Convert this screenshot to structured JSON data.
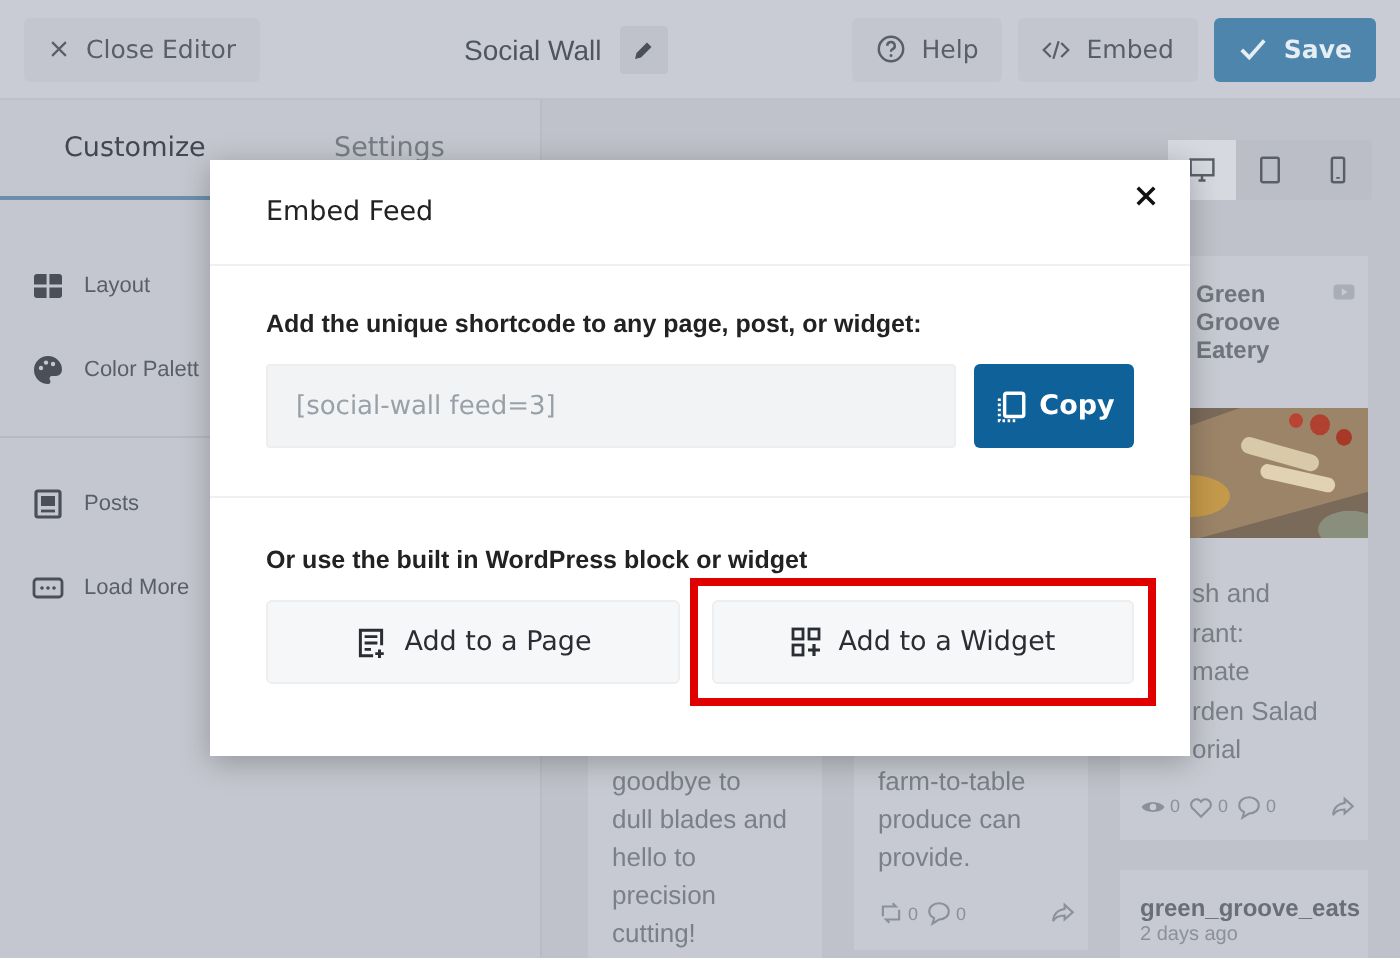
{
  "topbar": {
    "close": "Close Editor",
    "title": "Social Wall",
    "help": "Help",
    "embed": "Embed",
    "save": "Save"
  },
  "sidebar": {
    "tabs": [
      {
        "label": "Customize",
        "selected": true
      },
      {
        "label": "Settings",
        "selected": false
      }
    ],
    "items": [
      {
        "kind": "layout",
        "label": "Layout"
      },
      {
        "kind": "palette",
        "label": "Color Palett"
      },
      {
        "kind": "divider"
      },
      {
        "kind": "posts",
        "label": "Posts"
      },
      {
        "kind": "more",
        "label": "Load More"
      }
    ]
  },
  "preview": {
    "devices": [
      {
        "kind": "desktop",
        "selected": true
      },
      {
        "kind": "tablet",
        "selected": false
      },
      {
        "kind": "phone",
        "selected": false
      }
    ],
    "columns": [
      {
        "cards": [
          {
            "lines": [
              "goodbye to",
              "dull blades and",
              "hello to",
              "precision",
              "cutting!"
            ]
          }
        ]
      },
      {
        "cards": [
          {
            "lines": [
              "farm-to-table",
              "produce can",
              "provide."
            ],
            "stats": [
              {
                "kind": "retweet",
                "count": "0"
              },
              {
                "kind": "comment",
                "count": "0"
              },
              {
                "kind": "share"
              }
            ]
          }
        ]
      },
      {
        "cards": [
          {
            "author": "Green Groove Eatery",
            "picture": true,
            "lines": [
              "sh and",
              "rant:",
              "mate",
              "rden Salad",
              "orial"
            ],
            "stats": [
              {
                "kind": "views",
                "count": "0"
              },
              {
                "kind": "like",
                "count": "0"
              },
              {
                "kind": "comment",
                "count": "0"
              },
              {
                "kind": "share"
              }
            ]
          },
          {
            "handle": "green_groove_eats",
            "time": "2 days ago"
          }
        ]
      }
    ]
  },
  "modal": {
    "title": "Embed Feed",
    "shortcode_label": "Add the unique shortcode to any page, post, or widget:",
    "shortcode": "[social-wall feed=3]",
    "copy": "Copy",
    "block_label": "Or use the built in WordPress block or widget",
    "buttons": [
      {
        "label": "Add to a Page",
        "kind": "page",
        "highlighted": false
      },
      {
        "label": "Add to a Widget",
        "kind": "widget",
        "highlighted": true
      }
    ]
  }
}
